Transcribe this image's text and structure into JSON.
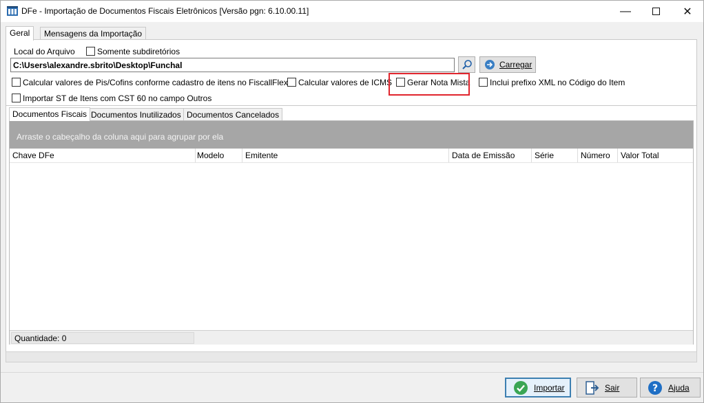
{
  "window": {
    "title": "DFe - Importação de Documentos Fiscais Eletrônicos [Versão pgn: 6.10.00.11]",
    "controls": [
      "minimize-icon",
      "maximize-icon",
      "close-icon"
    ]
  },
  "tabs": [
    {
      "label": "Geral",
      "active": true
    },
    {
      "label": "Mensagens da Importação",
      "active": false
    }
  ],
  "file": {
    "label": "Local do Arquivo",
    "subdirs_label": "Somente subdiretórios",
    "subdirs_checked": false,
    "path": "C:\\Users\\alexandre.sbrito\\Desktop\\Funchal",
    "browse_icon": "search-icon",
    "load_icon": "arrow-right-circle-icon",
    "load_label": "Carregar"
  },
  "options": [
    {
      "label": "Calcular valores de Pis/Cofins conforme cadastro de itens  no FiscallFlex",
      "checked": false
    },
    {
      "label": "Calcular valores de ICMS",
      "checked": false
    },
    {
      "label": "Gerar Nota Mista",
      "checked": false
    },
    {
      "label": "Inclui prefixo XML no Código do Item",
      "checked": false
    },
    {
      "label": "Importar ST de Itens com CST 60 no campo Outros",
      "checked": false
    }
  ],
  "doc_tabs": [
    {
      "label": "Documentos Fiscais",
      "active": true
    },
    {
      "label": "Documentos Inutilizados",
      "active": false
    },
    {
      "label": "Documentos Cancelados",
      "active": false
    }
  ],
  "grid": {
    "group_hint": "Arraste o cabeçalho da coluna aqui para agrupar por ela",
    "columns": [
      "Chave DFe",
      "Modelo",
      "Emitente",
      "Data de Emissão",
      "Série",
      "Número",
      "Valor Total"
    ],
    "rows": [],
    "quantity_label": "Quantidade: 0"
  },
  "actions": [
    {
      "label": "Importar",
      "icon": "check-circle-icon"
    },
    {
      "label": "Sair",
      "icon": "exit-door-icon"
    },
    {
      "label": "Ajuda",
      "icon": "help-icon"
    }
  ],
  "colors": {
    "highlight": "#e0242c",
    "primary_border": "#3c7fb1",
    "group_panel": "#a6a6a6",
    "check_green": "#3aa655",
    "help_blue": "#1f6fc5"
  }
}
